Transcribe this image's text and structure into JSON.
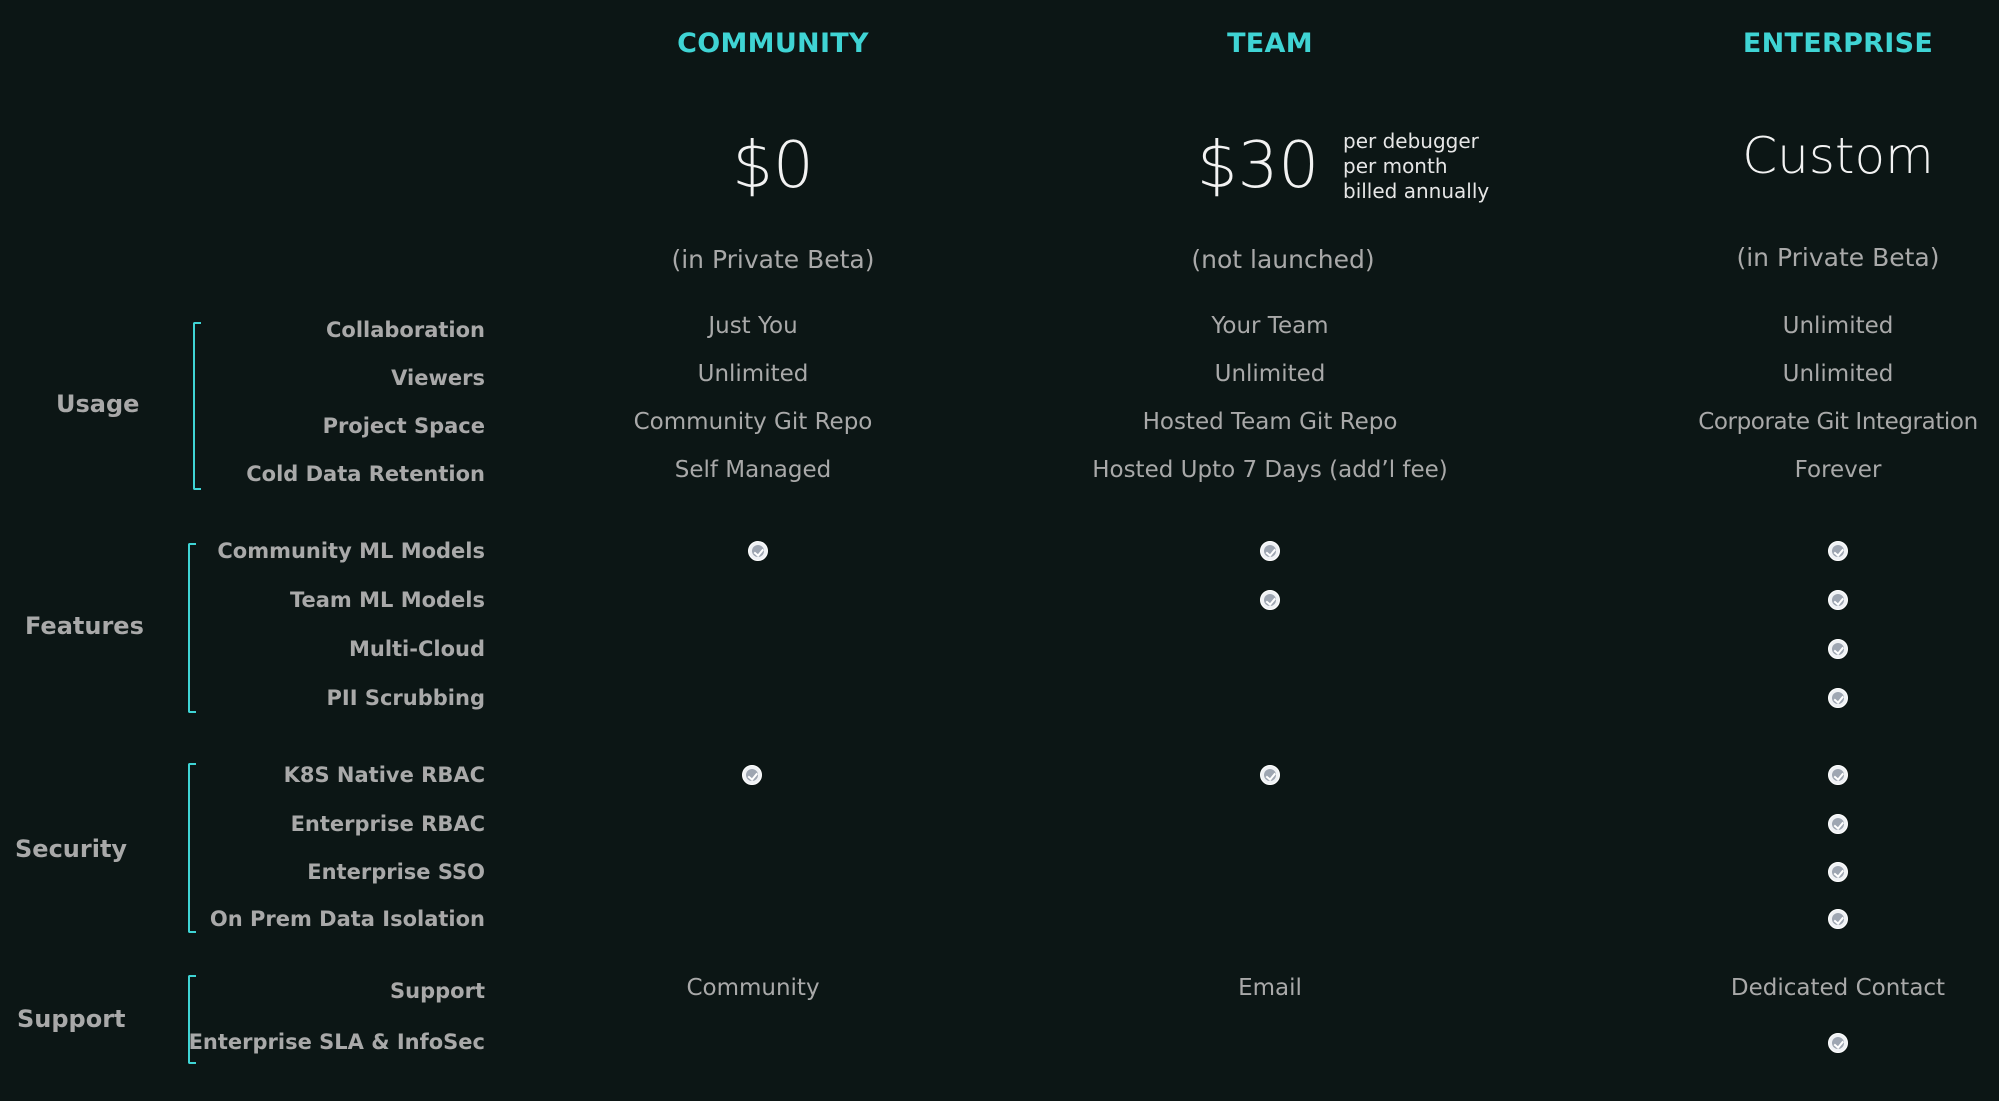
{
  "plans": [
    {
      "name": "COMMUNITY",
      "price": "$0",
      "status": "(in Private Beta)"
    },
    {
      "name": "TEAM",
      "price": "$30",
      "price_note": [
        "per debugger",
        "per month",
        "billed annually"
      ],
      "status": "(not launched)"
    },
    {
      "name": "ENTERPRISE",
      "price": "Custom",
      "status": "(in Private Beta)"
    }
  ],
  "groups": {
    "usage": "Usage",
    "features": "Features",
    "security": "Security",
    "support": "Support"
  },
  "rows": {
    "collaboration": {
      "label": "Collaboration",
      "values": [
        "Just You",
        "Your Team",
        "Unlimited"
      ]
    },
    "viewers": {
      "label": "Viewers",
      "values": [
        "Unlimited",
        "Unlimited",
        "Unlimited"
      ]
    },
    "project_space": {
      "label": "Project Space",
      "values": [
        "Community Git Repo",
        "Hosted Team Git Repo",
        "Corporate Git Integration"
      ]
    },
    "cold_data_retention": {
      "label": "Cold Data Retention",
      "values": [
        "Self Managed",
        "Hosted Upto 7 Days (add’l fee)",
        "Forever"
      ]
    },
    "community_ml_models": {
      "label": "Community ML Models",
      "included": [
        true,
        true,
        true
      ]
    },
    "team_ml_models": {
      "label": "Team ML Models",
      "included": [
        false,
        true,
        true
      ]
    },
    "multi_cloud": {
      "label": "Multi-Cloud",
      "included": [
        false,
        false,
        true
      ]
    },
    "pii_scrubbing": {
      "label": "PII Scrubbing",
      "included": [
        false,
        false,
        true
      ]
    },
    "k8s_native_rbac": {
      "label": "K8S Native RBAC",
      "included": [
        true,
        true,
        true
      ]
    },
    "enterprise_rbac": {
      "label": "Enterprise RBAC",
      "included": [
        false,
        false,
        true
      ]
    },
    "enterprise_sso": {
      "label": "Enterprise SSO",
      "included": [
        false,
        false,
        true
      ]
    },
    "on_prem_data_isolation": {
      "label": "On Prem Data Isolation",
      "included": [
        false,
        false,
        true
      ]
    },
    "support": {
      "label": "Support",
      "values": [
        "Community",
        "Email",
        "Dedicated Contact"
      ]
    },
    "enterprise_sla_infosec": {
      "label": "Enterprise SLA & InfoSec",
      "included": [
        false,
        false,
        true
      ]
    }
  },
  "colors": {
    "background": "#0c1615",
    "accent": "#3fd4d4",
    "text": "#a9a9a9",
    "price": "#f2f2f2"
  },
  "icons": {
    "included": "check-circle-icon"
  }
}
